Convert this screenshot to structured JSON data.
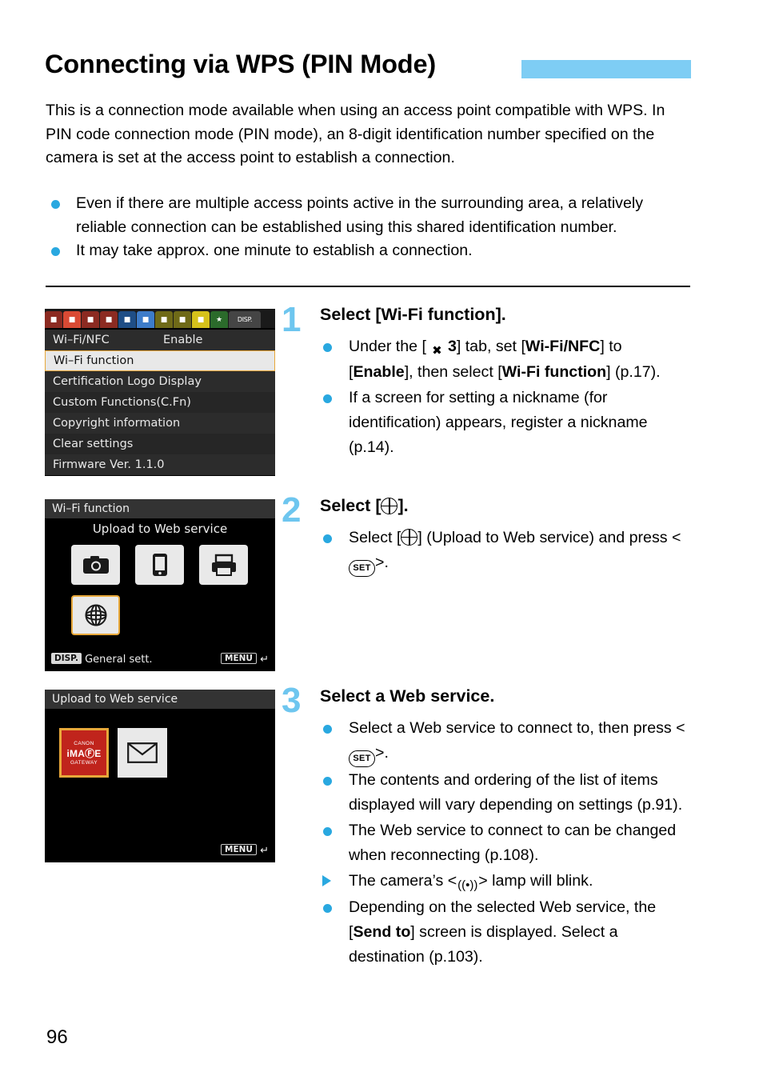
{
  "page": {
    "title": "Connecting via WPS (PIN Mode)",
    "number": "96",
    "accent_color": "#7ecdf4",
    "bullet_color": "#29a8e0",
    "intro": "This is a connection mode available when using an access point compatible with WPS. In PIN code connection mode (PIN mode), an 8-digit identification number specified on the camera is set at the access point to establish a connection.",
    "intro_bullets": [
      "Even if there are multiple access points active in the surrounding area, a relatively reliable connection can be established using this shared identification number.",
      "It may take approx. one minute to establish a connection."
    ]
  },
  "steps": [
    {
      "number": "1",
      "heading": "Select [Wi-Fi function].",
      "lines": [
        {
          "marker": "dot",
          "html": "Under the [<span class=\"glyph-wifi\">✖</span><b class=\"b\">3</b>] tab, set [<b class=\"b\">Wi-Fi/NFC</b>] to [<b class=\"b\">Enable</b>], then select [<b class=\"b\">Wi-Fi function</b>] (p.17)."
        },
        {
          "marker": "dot",
          "html": "If a screen for setting a nickname (for identification) appears, register a nickname (p.14)."
        }
      ]
    },
    {
      "number": "2",
      "heading": "Select [⊕].",
      "lines": [
        {
          "marker": "dot",
          "html": "Select [<span class=\"glyph-globe\"></span>] (Upload to Web service) and press <<span class=\"glyph-set\">SET</span>>."
        }
      ]
    },
    {
      "number": "3",
      "heading": "Select a Web service.",
      "lines": [
        {
          "marker": "dot",
          "html": "Select a Web service to connect to, then press <<span class=\"glyph-set\">SET</span>>."
        },
        {
          "marker": "dot",
          "html": "The contents and ordering of the list of items displayed will vary depending on settings (p.91)."
        },
        {
          "marker": "dot",
          "html": "The Web service to connect to can be changed when reconnecting (p.108)."
        },
        {
          "marker": "tri",
          "html": "The camera’s <<span class=\"glyph-wifi\">((•))</span>> lamp will blink."
        },
        {
          "marker": "dot",
          "html": "Depending on the selected Web service, the [<b class=\"b\">Send to</b>] screen is displayed. Select a destination (p.103)."
        }
      ]
    }
  ],
  "screens": {
    "menu": {
      "tabs": [
        {
          "kind": "red",
          "label": "■"
        },
        {
          "kind": "red on",
          "label": "■"
        },
        {
          "kind": "red",
          "label": "■"
        },
        {
          "kind": "red",
          "label": "■"
        },
        {
          "kind": "blue",
          "label": "■"
        },
        {
          "kind": "blue on",
          "label": "■"
        },
        {
          "kind": "olive",
          "label": "■"
        },
        {
          "kind": "olive",
          "label": "■"
        },
        {
          "kind": "yellowon",
          "label": "■"
        },
        {
          "kind": "green",
          "label": "★"
        },
        {
          "kind": "disp",
          "label": "DISP."
        }
      ],
      "rows": [
        {
          "label": "Wi–Fi/NFC",
          "value": "Enable",
          "selected": false
        },
        {
          "label": "Wi–Fi function",
          "value": "",
          "selected": true
        },
        {
          "label": "Certification Logo Display",
          "value": "",
          "selected": false
        },
        {
          "label": "Custom Functions(C.Fn)",
          "value": "",
          "selected": false
        },
        {
          "label": "Copyright information",
          "value": "",
          "selected": false
        },
        {
          "label": "Clear settings",
          "value": "",
          "selected": false
        },
        {
          "label": "Firmware Ver. 1.1.0",
          "value": "",
          "selected": false
        }
      ]
    },
    "wifi_function": {
      "header": "Wi–Fi function",
      "subtitle": "Upload to Web service",
      "icons": [
        {
          "name": "camera-icon",
          "glyph": "📷",
          "selected": false
        },
        {
          "name": "smartphone-icon",
          "glyph": "▯",
          "selected": false
        },
        {
          "name": "printer-icon",
          "glyph": "⎙",
          "selected": false
        },
        {
          "name": "web-service-icon",
          "glyph": "⊕",
          "selected": true
        }
      ],
      "footer_left_chip": "DISP.",
      "footer_left_label": "General sett.",
      "footer_right_chip": "MENU",
      "footer_right_arrow": "↵"
    },
    "web_service": {
      "header": "Upload to Web service",
      "tiles": [
        {
          "name": "canon-image-gateway-tile",
          "line1": "CANON",
          "line2": "iMAⒻE",
          "line3": "GATEWAY",
          "selected": true
        },
        {
          "name": "email-tile",
          "glyph": "✉",
          "selected": false
        }
      ],
      "footer_right_chip": "MENU",
      "footer_right_arrow": "↵"
    }
  }
}
